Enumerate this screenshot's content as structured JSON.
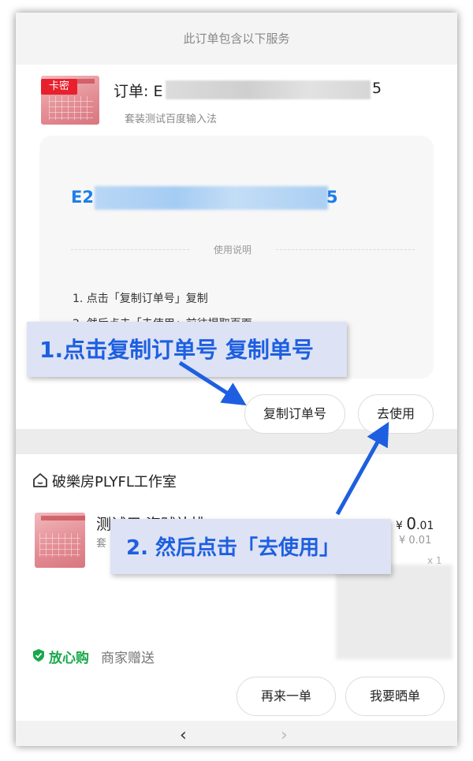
{
  "sheet": {
    "title": "此订单包含以下服务"
  },
  "order": {
    "badge": "卡密",
    "label": "订单: E",
    "number_tail": "5",
    "subtitle": "套装测试百度输入法"
  },
  "code_panel": {
    "prefix": "E2",
    "tail": "5",
    "usage_title": "使用说明",
    "steps": [
      "1.  点击「复制订单号」复制",
      "2.  然后点击「去使用」前往提取页面"
    ]
  },
  "buttons": {
    "copy_order": "复制订单号",
    "use": "去使用",
    "reorder": "再来一单",
    "review": "我要晒单"
  },
  "shop": {
    "name": "破樂房PLYFL工作室",
    "item_title": "测试用 盗贼补桃",
    "item_sub": "套",
    "price_symbol": "¥",
    "price_int": "0",
    "price_dec": ".01",
    "price_orig": "¥ 0.01",
    "qty": "x 1",
    "trust_label": "放心购",
    "gift_label": "商家赠送"
  },
  "annotations": {
    "step1": "1.点击复制订单号 复制单号",
    "step2": "2. 然后点击「去使用」"
  },
  "nav": {
    "back": "‹",
    "forward": "›"
  },
  "colors": {
    "accent_blue": "#1f7ee8",
    "annotation_blue": "#1d5fe0",
    "badge_red": "#e8202d",
    "trust_green": "#17a84a"
  },
  "icons": [
    "home-icon",
    "shield-check-icon",
    "back-icon",
    "forward-icon"
  ]
}
